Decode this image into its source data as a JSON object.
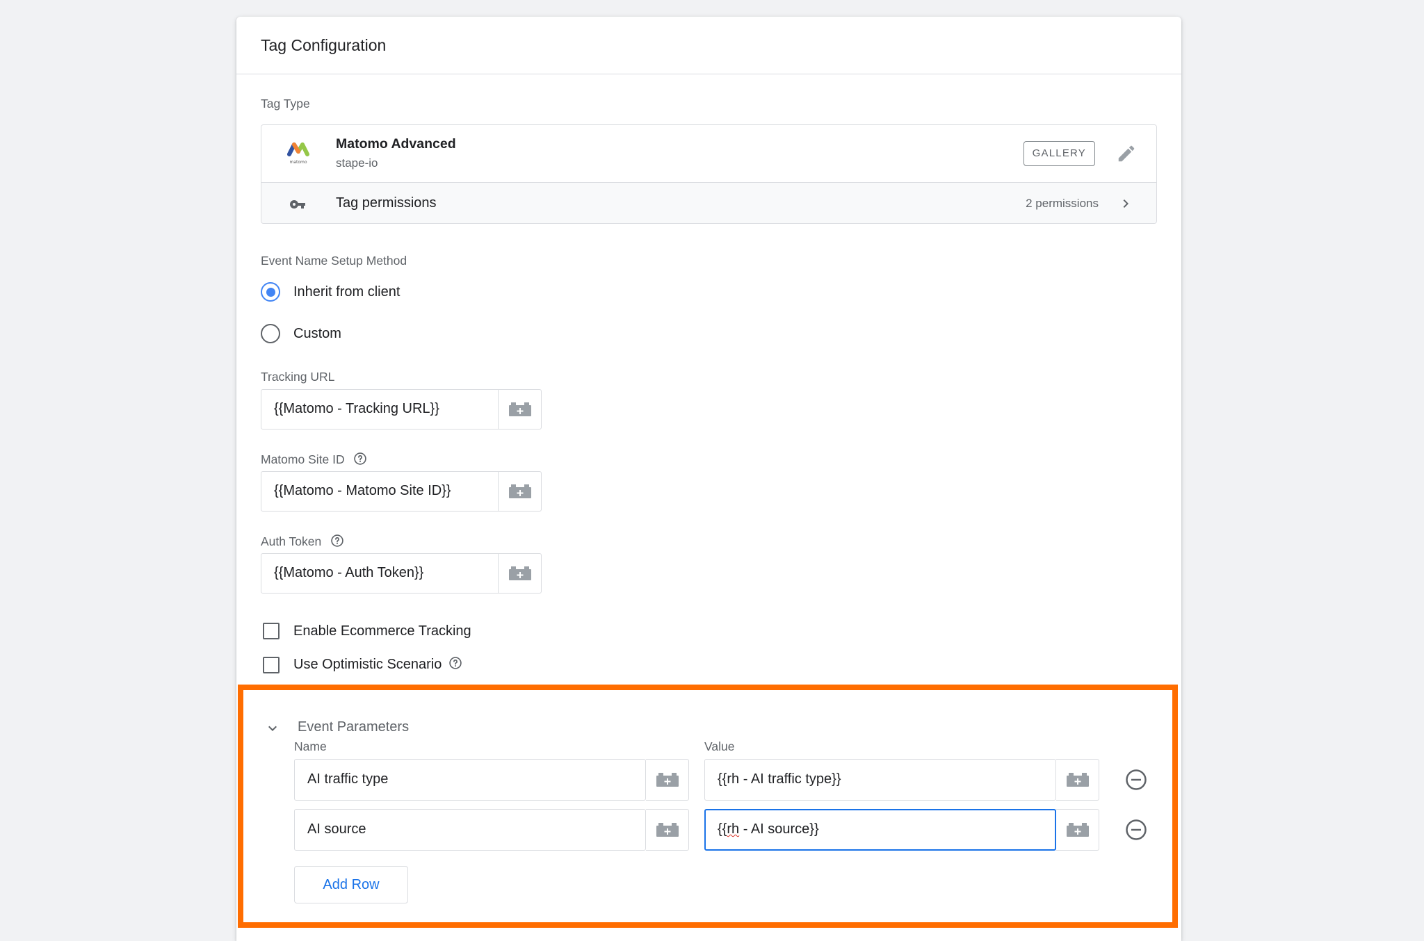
{
  "header": {
    "title": "Tag Configuration"
  },
  "tag_type": {
    "label": "Tag Type",
    "name": "Matomo Advanced",
    "vendor": "stape-io",
    "gallery_label": "GALLERY",
    "permissions_label": "Tag permissions",
    "permissions_count": "2 permissions",
    "logo_text": "matomo"
  },
  "event_name": {
    "label": "Event Name Setup Method",
    "options": [
      {
        "label": "Inherit from client",
        "selected": true
      },
      {
        "label": "Custom",
        "selected": false
      }
    ]
  },
  "tracking_url": {
    "label": "Tracking URL",
    "value": "{{Matomo - Tracking URL}}"
  },
  "site_id": {
    "label": "Matomo Site ID",
    "value": "{{Matomo - Matomo Site ID}}"
  },
  "auth_token": {
    "label": "Auth Token",
    "value": "{{Matomo - Auth Token}}"
  },
  "checkboxes": [
    {
      "label": "Enable Ecommerce Tracking",
      "checked": false
    },
    {
      "label": "Use Optimistic Scenario",
      "checked": false
    }
  ],
  "event_parameters": {
    "title": "Event Parameters",
    "name_col": "Name",
    "value_col": "Value",
    "rows": [
      {
        "name": "AI traffic type",
        "value": "{{rh - AI traffic type}}"
      },
      {
        "name": "AI source",
        "value_prefix": "{{",
        "value_misspelled": "rh",
        "value_suffix": " - AI source}}"
      }
    ],
    "add_row_label": "Add Row"
  },
  "colors": {
    "highlight": "#ff6d00",
    "accent": "#1a73e8",
    "radio": "#4285f4"
  }
}
